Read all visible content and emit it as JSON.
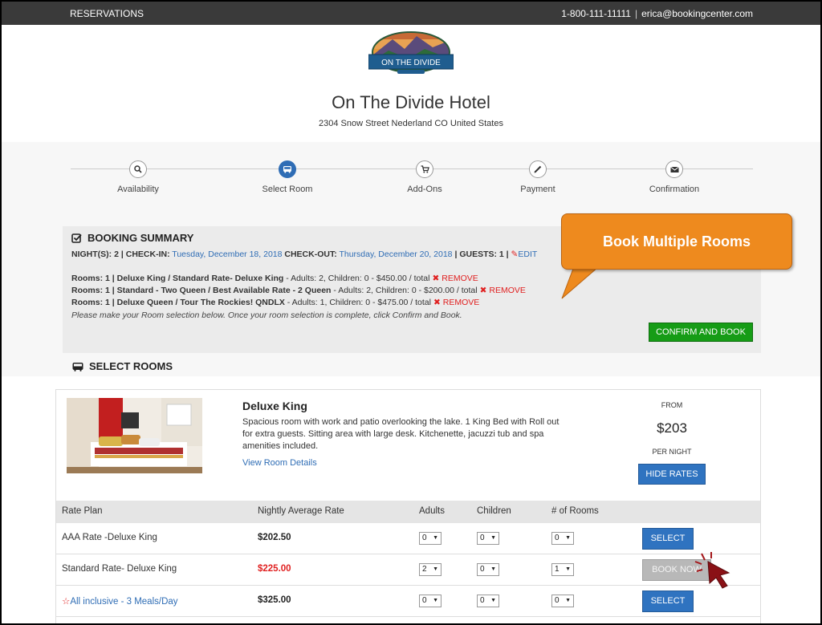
{
  "topbar": {
    "reservations": "RESERVATIONS",
    "phone": "1-800-111-11111",
    "separator": "|",
    "email": "erica@bookingcenter.com"
  },
  "header": {
    "logo_text": "ON THE DIVIDE",
    "hotel_name": "On The Divide Hotel",
    "address": "2304 Snow Street Nederland CO United States"
  },
  "steps": [
    {
      "label": "Availability",
      "icon": "search-icon",
      "active": false
    },
    {
      "label": "Select Room",
      "icon": "bus-icon",
      "active": true
    },
    {
      "label": "Add-Ons",
      "icon": "cart-icon",
      "active": false
    },
    {
      "label": "Payment",
      "icon": "pencil-icon",
      "active": false
    },
    {
      "label": "Confirmation",
      "icon": "envelope-icon",
      "active": false
    }
  ],
  "summary": {
    "title": "BOOKING SUMMARY",
    "nights_label": "NIGHT(S):",
    "nights": "2",
    "checkin_label": "CHECK-IN:",
    "checkin": "Tuesday, December 18, 2018",
    "checkout_label": "CHECK-OUT:",
    "checkout": "Thursday, December 20, 2018",
    "guests_label": "GUESTS:",
    "guests": "1",
    "edit": "EDIT",
    "rooms": [
      {
        "prefix": "Rooms: 1 | Deluxe King / Standard Rate- Deluxe King",
        "detail": " - Adults: 2, Children: 0 - $450.00 / total",
        "remove": "REMOVE"
      },
      {
        "prefix": "Rooms: 1 | Standard - Two Queen / Best Available Rate - 2 Queen",
        "detail": " - Adults: 2, Children: 0 - $200.00 / total",
        "remove": "REMOVE"
      },
      {
        "prefix": "Rooms: 1 | Deluxe Queen / Tour The Rockies! QNDLX",
        "detail": " - Adults: 1, Children: 0 - $475.00 / total",
        "remove": "REMOVE"
      }
    ],
    "note": "Please make your Room selection below. Once your room selection is complete, click Confirm and Book.",
    "confirm_button": "CONFIRM AND BOOK"
  },
  "callout": {
    "text": "Book Multiple Rooms"
  },
  "select_rooms": {
    "title": "SELECT ROOMS"
  },
  "room": {
    "name": "Deluxe King",
    "description": "Spacious room with work and patio overlooking the lake. 1 King Bed with Roll out for extra guests. Sitting area with large desk. Kitchenette, jacuzzi tub and spa amenities included.",
    "details_link": "View Room Details",
    "from": "FROM",
    "price": "$203",
    "per_night": "PER NIGHT",
    "hide_rates": "HIDE RATES"
  },
  "rate_table": {
    "headers": [
      "Rate Plan",
      "Nightly Average Rate",
      "Adults",
      "Children",
      "# of Rooms"
    ],
    "rows": [
      {
        "plan": "AAA Rate -Deluxe King",
        "rate": "$202.50",
        "adults": "0",
        "children": "0",
        "rooms": "0",
        "button": "SELECT"
      },
      {
        "plan": "Standard Rate- Deluxe King",
        "rate": "$225.00",
        "adults": "2",
        "children": "0",
        "rooms": "1",
        "button": "BOOK NOW"
      },
      {
        "plan": "All inclusive - 3 Meals/Day",
        "rate": "$325.00",
        "adults": "0",
        "children": "0",
        "rooms": "0",
        "button": "SELECT"
      }
    ]
  },
  "colors": {
    "topbar": "#3a3a3a",
    "accent_blue": "#2f73c0",
    "confirm_green": "#169c16",
    "callout_orange": "#ee8a1e",
    "price_red": "#e02020"
  }
}
